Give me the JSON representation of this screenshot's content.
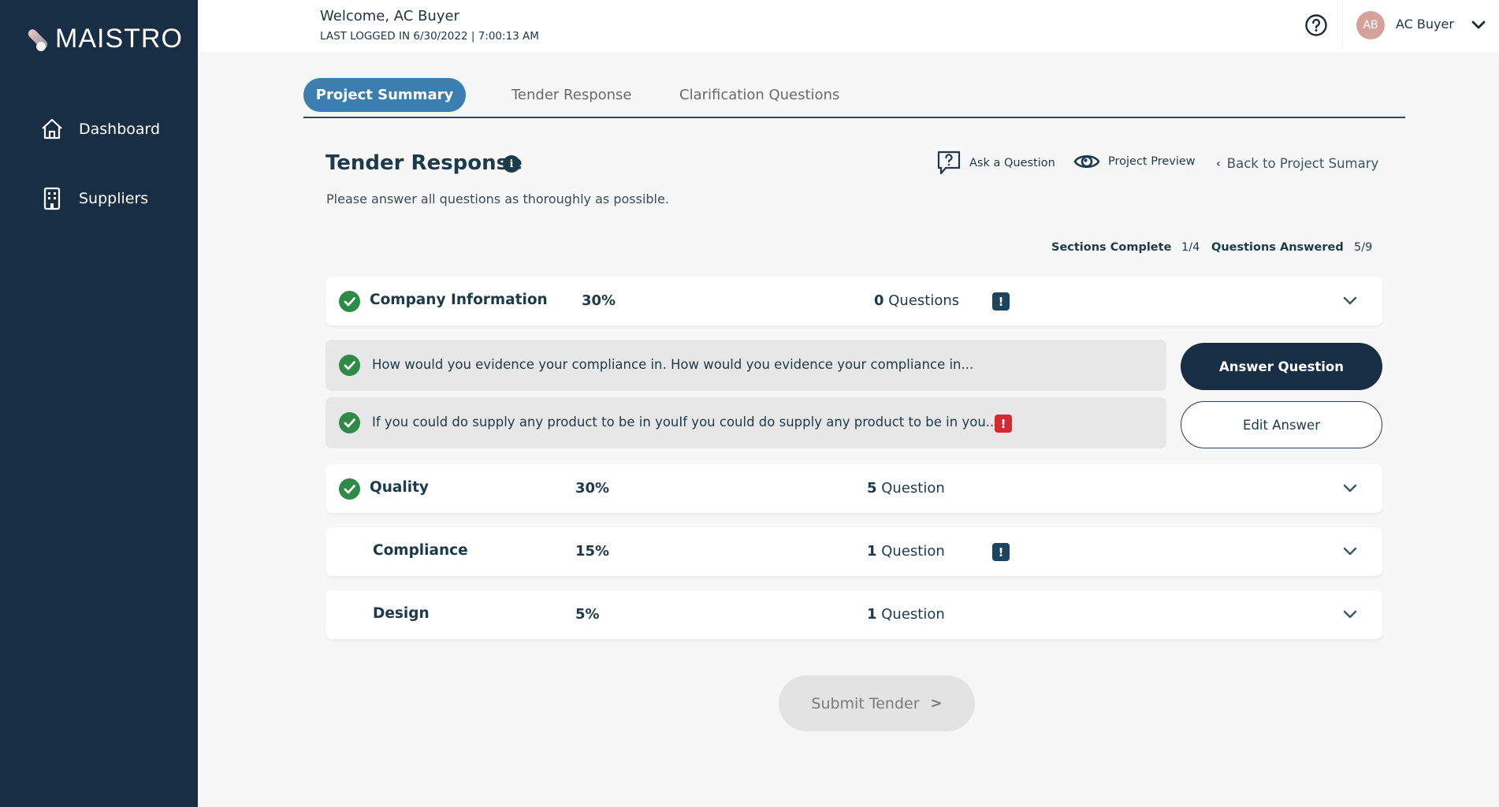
{
  "app": {
    "brand": "MAISTRO"
  },
  "sidebar": {
    "items": [
      {
        "label": "Dashboard",
        "icon": "home-icon"
      },
      {
        "label": "Suppliers",
        "icon": "building-icon"
      }
    ]
  },
  "header": {
    "welcome": "Welcome, AC Buyer",
    "last_login": "LAST LOGGED IN 6/30/2022 | 7:00:13 AM",
    "avatar_initials": "AB",
    "user_name": "AC Buyer"
  },
  "tabs": [
    {
      "label": "Project Summary",
      "active": true
    },
    {
      "label": "Tender Response",
      "active": false
    },
    {
      "label": "Clarification Questions",
      "active": false
    }
  ],
  "page": {
    "title": "Tender Response",
    "info_glyph": "i",
    "subtitle": "Please answer all questions as thoroughly as possible."
  },
  "actions": {
    "ask": "Ask a Question",
    "preview": "Project Preview",
    "back": "Back to Project Sumary",
    "back_glyph": "‹"
  },
  "stats": {
    "sections_label": "Sections Complete",
    "sections_value": "1/4",
    "questions_label": "Questions Answered",
    "questions_value": "5/9"
  },
  "sections": [
    {
      "name": "Company Information",
      "weight": "30%",
      "questions_count": "0",
      "questions_label": "Questions",
      "complete": true,
      "alert": true
    },
    {
      "name": "Quality",
      "weight": "30%",
      "questions_count": "5",
      "questions_label": "Question",
      "complete": true,
      "alert": false
    },
    {
      "name": "Compliance",
      "weight": "15%",
      "questions_count": "1",
      "questions_label": "Question",
      "complete": false,
      "alert": true
    },
    {
      "name": "Design",
      "weight": "5%",
      "questions_count": "1",
      "questions_label": "Question",
      "complete": false,
      "alert": false
    }
  ],
  "questions": [
    {
      "text": "How would you evidence your compliance in. How would you evidence your compliance in...",
      "answered": true,
      "alert": false
    },
    {
      "text": "If you could do supply any product to be in youIf you could do supply any product to be in you...",
      "answered": true,
      "alert": true
    }
  ],
  "alert_glyph": "!",
  "buttons": {
    "answer": "Answer Question",
    "edit": "Edit Answer",
    "submit": "Submit Tender",
    "submit_arrow": ">"
  },
  "colors": {
    "sidebar": "#182e44",
    "accent": "#3a7fb0",
    "success": "#2e8b47",
    "alert_dark": "#1c4461",
    "alert_red": "#d42b32"
  }
}
